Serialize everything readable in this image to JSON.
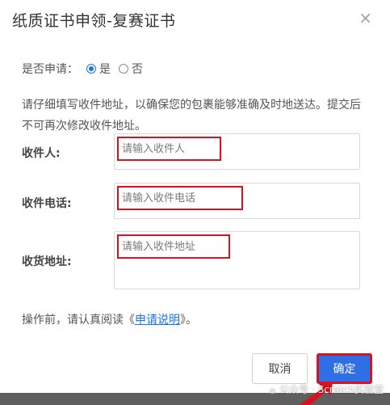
{
  "dialog": {
    "title": "纸质证书申领-复赛证书",
    "close_glyph": "×"
  },
  "apply": {
    "label": "是否申请：",
    "options": [
      {
        "label": "是",
        "checked": true
      },
      {
        "label": "否",
        "checked": false
      }
    ]
  },
  "notice": {
    "text": "请仔细填写收件地址，以确保您的包裹能够准确及时地送达。提交后不可再次修改收件地址。"
  },
  "fields": {
    "recipient": {
      "label": "收件人:",
      "placeholder": "请输入收件人"
    },
    "phone": {
      "label": "收件电话:",
      "placeholder": "请输入收件电话"
    },
    "address": {
      "label": "收货地址:",
      "placeholder": "请输入收件地址"
    }
  },
  "read_notice": {
    "prefix": "操作前，请认真阅读《",
    "link": "申请说明",
    "suffix": "》。"
  },
  "buttons": {
    "cancel": "取消",
    "ok": "确定"
  },
  "watermark": {
    "text": "公众号 · Scratch实验室"
  },
  "colors": {
    "accent": "#2f6fe6",
    "highlight": "#d9121f"
  }
}
